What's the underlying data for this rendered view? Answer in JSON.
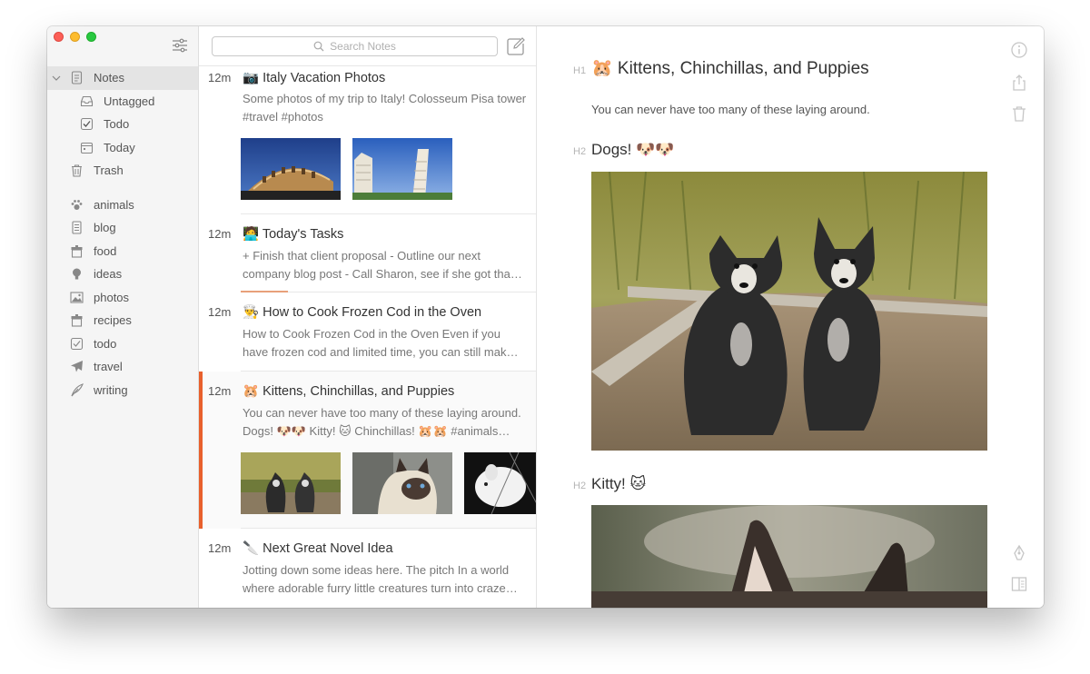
{
  "sidebar": {
    "items": [
      {
        "label": "Notes",
        "icon": "notes-icon",
        "level": 0,
        "selected": true
      },
      {
        "label": "Untagged",
        "icon": "inbox-icon",
        "level": 1
      },
      {
        "label": "Todo",
        "icon": "checkbox-icon",
        "level": 1
      },
      {
        "label": "Today",
        "icon": "calendar-icon",
        "level": 1
      },
      {
        "label": "Trash",
        "icon": "trash-icon",
        "level": 0
      }
    ],
    "tags": [
      {
        "label": "animals",
        "icon": "paw-icon"
      },
      {
        "label": "blog",
        "icon": "document-icon"
      },
      {
        "label": "food",
        "icon": "box-icon"
      },
      {
        "label": "ideas",
        "icon": "lightbulb-icon"
      },
      {
        "label": "photos",
        "icon": "image-icon"
      },
      {
        "label": "recipes",
        "icon": "box-icon"
      },
      {
        "label": "todo",
        "icon": "checkbox-icon"
      },
      {
        "label": "travel",
        "icon": "airplane-icon"
      },
      {
        "label": "writing",
        "icon": "feather-icon"
      }
    ]
  },
  "search": {
    "placeholder": "Search Notes"
  },
  "notes": [
    {
      "time": "12m",
      "emoji": "📷",
      "title": "Italy Vacation Photos",
      "preview": "Some photos of my trip to Italy! Colosseum Pisa tower #travel #photos"
    },
    {
      "time": "12m",
      "emoji": "🧑‍💻",
      "title": "Today's Tasks",
      "preview": "+ Finish that client proposal - Outline our next company blog post - Call Sharon, see if she got tha…"
    },
    {
      "time": "12m",
      "emoji": "👨‍🍳",
      "title": "How to Cook Frozen Cod in the Oven",
      "preview": "How to Cook Frozen Cod in the Oven Even if you have frozen cod and limited time, you can still mak…"
    },
    {
      "time": "12m",
      "emoji": "🐹",
      "title": "Kittens, Chinchillas, and Puppies",
      "preview": "You can never have too many of these laying around. Dogs! 🐶🐶 Kitty! 🐱 Chinchillas! 🐹🐹 #animals…"
    },
    {
      "time": "12m",
      "emoji": "🔪",
      "title": "Next Great Novel Idea",
      "preview": "Jotting down some ideas here. The pitch In a world where adorable furry little creatures turn into craze…"
    }
  ],
  "editor": {
    "h1_marker": "H1",
    "h1": "🐹 Kittens, Chinchillas, and Puppies",
    "paragraph": "You can never have too many of these laying around.",
    "h2a_marker": "H2",
    "h2a": "Dogs! 🐶🐶",
    "h2b_marker": "H2",
    "h2b": "Kitty! 🐱"
  },
  "colors": {
    "accent": "#e8602c",
    "sidebar_bg": "#f5f5f5",
    "selected_bg": "#e4e4e4"
  }
}
